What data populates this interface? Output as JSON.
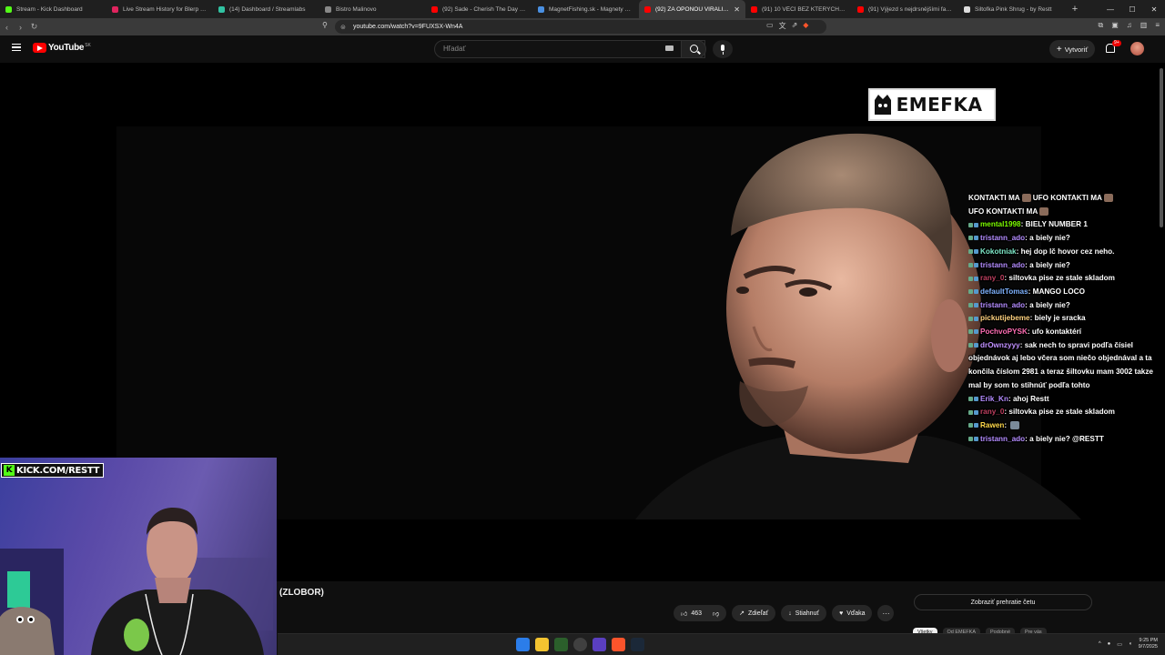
{
  "browser": {
    "tabs": [
      {
        "label": "Stream - Kick Dashboard",
        "color": "#53fc18"
      },
      {
        "label": "Live Stream History for Blerp Share",
        "color": "#e0245e"
      },
      {
        "label": "(14) Dashboard / Streamlabs",
        "color": "#31c3a2"
      },
      {
        "label": "Bistro Malinovo",
        "color": "#888888"
      },
      {
        "label": "(92) Sade - Cherish The Day - Offic",
        "color": "#ff0000"
      },
      {
        "label": "MagnetFishing.sk - Magnety a lano",
        "color": "#4a90e2"
      },
      {
        "label": "(92) ZA OPONOU VIRALITY",
        "color": "#ff0000",
        "active": true
      },
      {
        "label": "(91) 10 VĚCÍ BEZ KTERÝCH G3NTE",
        "color": "#ff0000"
      },
      {
        "label": "(91) Výjezd s nejdrsnějšími fanoušk",
        "color": "#ff0000"
      },
      {
        "label": "Šiltofka Pink Shrug - by Restt",
        "color": "#dddddd"
      }
    ],
    "new_tab": "+",
    "url": "youtube.com/watch?v=9FUXSX-Wn4A"
  },
  "youtube": {
    "logo": "YouTube",
    "country": "SK",
    "search_placeholder": "Hľadať",
    "create_label": "Vytvoriť",
    "notif_count": "9+",
    "video_title": "(ZLOBOR)",
    "likes": "463",
    "share_label": "Zdieľať",
    "download_label": "Stiahnuť",
    "thanks_label": "Vďaka",
    "more_label": "···",
    "replay_chat_label": "Zobraziť prehratie četu",
    "chips": [
      {
        "label": "Všetky",
        "active": true
      },
      {
        "label": "Od EMEFKA"
      },
      {
        "label": "Podobné"
      },
      {
        "label": "Pre vás"
      }
    ]
  },
  "overlay": {
    "emefka_logo": "EMEFKA",
    "kick_badge": "KICK.COM/RESTT",
    "chat": [
      {
        "user": "",
        "color": "#ffffff",
        "msg": "KONTAKTI MA",
        "emote": true,
        "tail": "UFO KONTAKTI MA",
        "emote2": true
      },
      {
        "user": "",
        "color": "#ffffff",
        "msg": "UFO KONTAKTI MA",
        "emote": true
      },
      {
        "user": "mental1998",
        "color": "#7cfc00",
        "msg": "BIELY NUMBER 1"
      },
      {
        "user": "tristann_ado",
        "color": "#b48cff",
        "msg": "a biely nie?"
      },
      {
        "user": "Kokotniak",
        "color": "#7ee8c8",
        "msg": "hej dop lč hovor cez neho."
      },
      {
        "user": "tristann_ado",
        "color": "#b48cff",
        "msg": "a biely nie?"
      },
      {
        "user": "rany_0",
        "color": "#c04060",
        "msg": "siltovka pise ze stale skladom"
      },
      {
        "user": "defaultTomas",
        "color": "#7fb3ff",
        "msg": "MANGO LOCO"
      },
      {
        "user": "tristann_ado",
        "color": "#b48cff",
        "msg": "a biely nie?"
      },
      {
        "user": "pickutijebeme",
        "color": "#ffd27f",
        "msg": "biely je sracka"
      },
      {
        "user": "PochvoPYSK",
        "color": "#ff6eb4",
        "msg": "ufo kontaktérí"
      },
      {
        "user": "drOwnzyyy",
        "color": "#c090ff",
        "msg": "sak nech to spravi podľa čísiel objednávok aj lebo včera som niečo objednával a ta končila číslom 2981 a teraz šiltovku mam 3002 takze mal by som to stihnúť podľa tohto",
        "wrap": true
      },
      {
        "user": "Erik_Kn",
        "color": "#b48cff",
        "msg": "ahoj Restt"
      },
      {
        "user": "rany_0",
        "color": "#c04060",
        "msg": "siltovka pise ze stale skladom"
      },
      {
        "user": "Rawen",
        "color": "#ffd84a",
        "msg": ""
      },
      {
        "user": "tristann_ado",
        "color": "#b48cff",
        "msg": "a biely nie? @RESTT"
      }
    ]
  },
  "taskbar": {
    "time": "9:25 PM",
    "date": "9/7/2025"
  }
}
